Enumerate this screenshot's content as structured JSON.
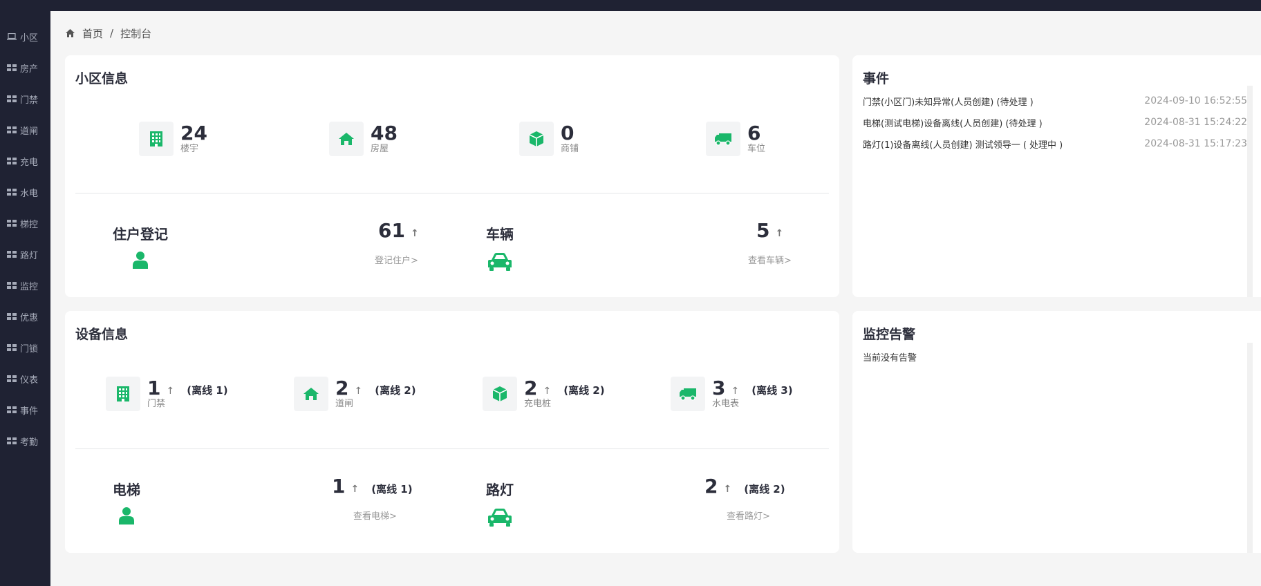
{
  "sidebar": {
    "items": [
      {
        "label": "小区",
        "icon": "laptop-icon"
      },
      {
        "label": "房产",
        "icon": "grid-icon"
      },
      {
        "label": "门禁",
        "icon": "grid-icon"
      },
      {
        "label": "道闸",
        "icon": "grid-icon"
      },
      {
        "label": "充电",
        "icon": "grid-icon"
      },
      {
        "label": "水电",
        "icon": "grid-icon"
      },
      {
        "label": "梯控",
        "icon": "grid-icon"
      },
      {
        "label": "路灯",
        "icon": "grid-icon"
      },
      {
        "label": "监控",
        "icon": "grid-icon"
      },
      {
        "label": "优惠",
        "icon": "grid-icon"
      },
      {
        "label": "门锁",
        "icon": "grid-icon"
      },
      {
        "label": "仪表",
        "icon": "grid-icon"
      },
      {
        "label": "事件",
        "icon": "grid-icon"
      },
      {
        "label": "考勤",
        "icon": "grid-icon"
      }
    ]
  },
  "breadcrumb": {
    "home": "首页",
    "separator": "/",
    "current": "控制台"
  },
  "community": {
    "title": "小区信息",
    "stats": [
      {
        "num": "24",
        "label": "楼宇",
        "icon": "building-icon"
      },
      {
        "num": "48",
        "label": "房屋",
        "icon": "home-icon"
      },
      {
        "num": "0",
        "label": "商铺",
        "icon": "cube-icon"
      },
      {
        "num": "6",
        "label": "车位",
        "icon": "truck-icon"
      }
    ],
    "resident": {
      "title": "住户登记",
      "num": "61",
      "arrow": "↑",
      "link": "登记住户>"
    },
    "vehicle": {
      "title": "车辆",
      "num": "5",
      "arrow": "↑",
      "link": "查看车辆>"
    }
  },
  "events": {
    "title": "事件",
    "rows": [
      {
        "text": "门禁(小区门)未知异常(人员创建) (待处理 )",
        "time": "2024-09-10 16:52:55"
      },
      {
        "text": "电梯(测试电梯)设备离线(人员创建) (待处理 )",
        "time": "2024-08-31 15:24:22"
      },
      {
        "text": "路灯(1)设备离线(人员创建) 测试领导一 ( 处理中 )",
        "time": "2024-08-31 15:17:23"
      }
    ]
  },
  "devices": {
    "title": "设备信息",
    "stats": [
      {
        "num": "1",
        "arrow": "↑",
        "offline": "(离线 1)",
        "label": "门禁",
        "icon": "building-icon"
      },
      {
        "num": "2",
        "arrow": "↑",
        "offline": "(离线 2)",
        "label": "道闸",
        "icon": "home-icon"
      },
      {
        "num": "2",
        "arrow": "↑",
        "offline": "(离线 2)",
        "label": "充电桩",
        "icon": "cube-icon"
      },
      {
        "num": "3",
        "arrow": "↑",
        "offline": "(离线 3)",
        "label": "水电表",
        "icon": "truck-icon"
      }
    ],
    "elevator": {
      "title": "电梯",
      "num": "1",
      "arrow": "↑",
      "offline": "(离线 1)",
      "link": "查看电梯>"
    },
    "streetlight": {
      "title": "路灯",
      "num": "2",
      "arrow": "↑",
      "offline": "(离线 2)",
      "link": "查看路灯>"
    }
  },
  "alarms": {
    "title": "监控告警",
    "empty_text": "当前没有告警"
  },
  "colors": {
    "accent": "#1ab76a",
    "sidebar": "#1f2233",
    "background": "#f5f5f5"
  }
}
